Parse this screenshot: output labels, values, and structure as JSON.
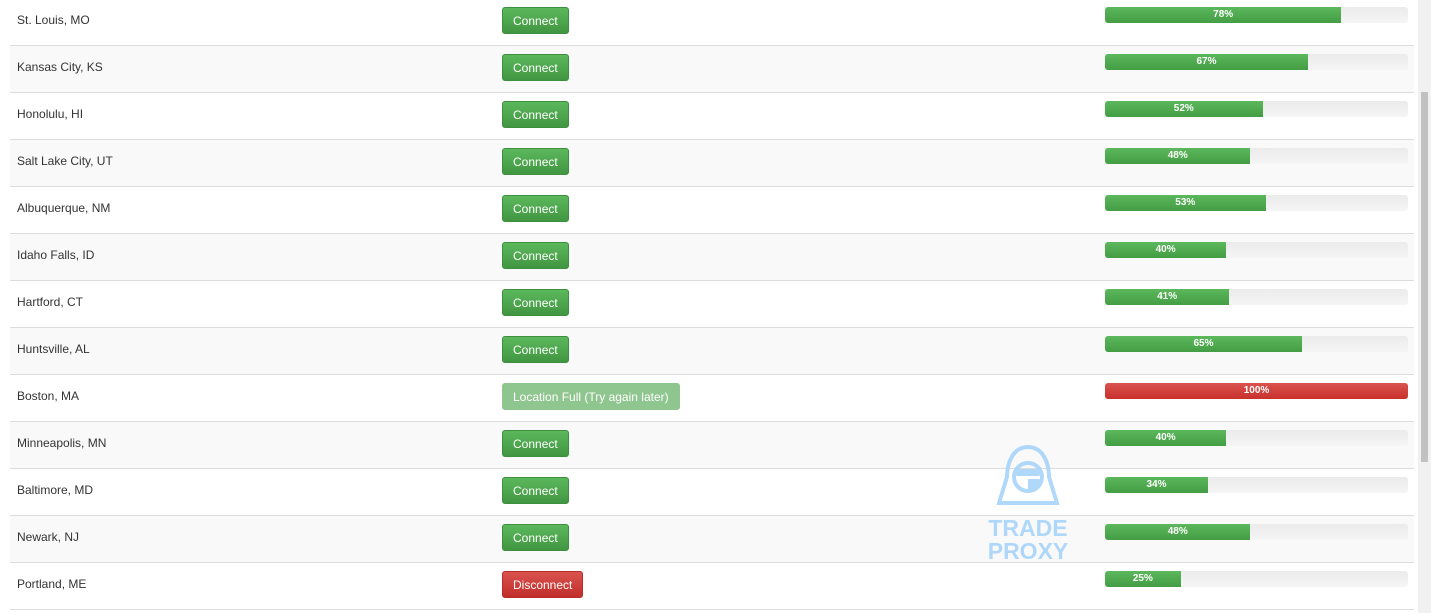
{
  "colors": {
    "success": "#5cb85c",
    "danger": "#d9534f",
    "disabled": "#8fc58f"
  },
  "rows": [
    {
      "location": "St. Louis, MO",
      "action": "Connect",
      "state": "connect",
      "load": 78
    },
    {
      "location": "Kansas City, KS",
      "action": "Connect",
      "state": "connect",
      "load": 67
    },
    {
      "location": "Honolulu, HI",
      "action": "Connect",
      "state": "connect",
      "load": 52
    },
    {
      "location": "Salt Lake City, UT",
      "action": "Connect",
      "state": "connect",
      "load": 48
    },
    {
      "location": "Albuquerque, NM",
      "action": "Connect",
      "state": "connect",
      "load": 53
    },
    {
      "location": "Idaho Falls, ID",
      "action": "Connect",
      "state": "connect",
      "load": 40
    },
    {
      "location": "Hartford, CT",
      "action": "Connect",
      "state": "connect",
      "load": 41
    },
    {
      "location": "Huntsville, AL",
      "action": "Connect",
      "state": "connect",
      "load": 65
    },
    {
      "location": "Boston, MA",
      "action": "Location Full (Try again later)",
      "state": "full",
      "load": 100
    },
    {
      "location": "Minneapolis, MN",
      "action": "Connect",
      "state": "connect",
      "load": 40
    },
    {
      "location": "Baltimore, MD",
      "action": "Connect",
      "state": "connect",
      "load": 34
    },
    {
      "location": "Newark, NJ",
      "action": "Connect",
      "state": "connect",
      "load": 48
    },
    {
      "location": "Portland, ME",
      "action": "Disconnect",
      "state": "disconnect",
      "load": 25
    }
  ],
  "watermark": {
    "line1": "TRADE",
    "line2": "PROXY"
  }
}
